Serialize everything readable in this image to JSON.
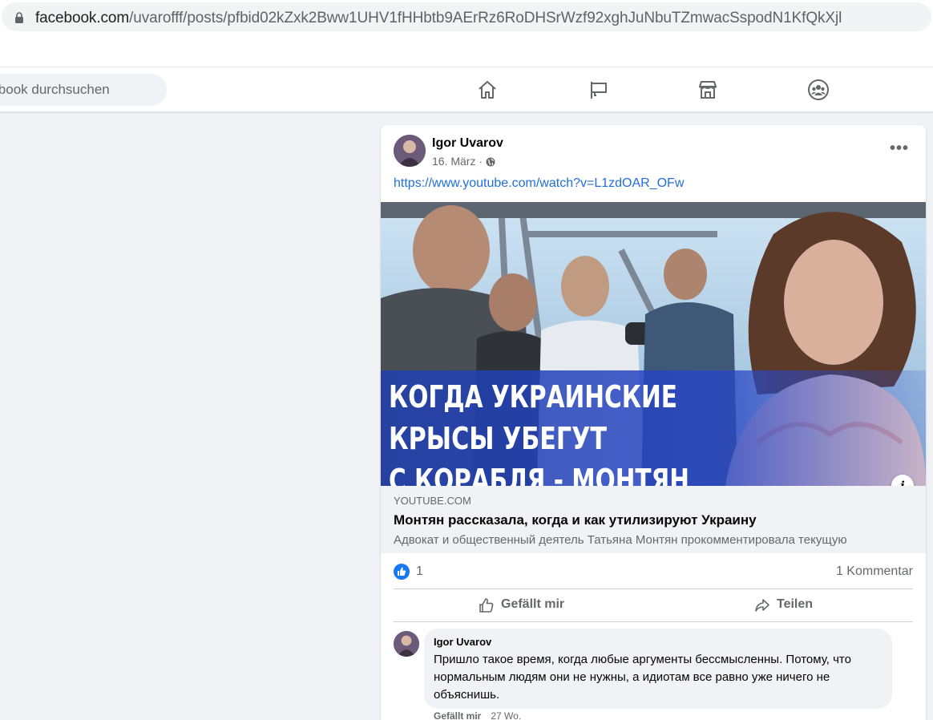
{
  "browser": {
    "url_host": "facebook.com",
    "url_path": "/uvarofff/posts/pfbid02kZxk2Bww1UHV1fHHbtb9AErRz6RoDHSrWzf92xghJuNbuTZmwacSspodN1KfQkXjl"
  },
  "nav": {
    "search_placeholder": "Facebook durchsuchen",
    "icons": [
      "home-icon",
      "pages-flag-icon",
      "marketplace-icon",
      "groups-icon"
    ]
  },
  "post": {
    "author": "Igor Uvarov",
    "date": "16. März · ",
    "link": "https://www.youtube.com/watch?v=L1zdOAR_OFw",
    "thumbnail_caption": [
      "КОГДА УКРАИНСКИЕ",
      "КРЫСЫ УБЕГУТ",
      "С КОРАБЛЯ - МОНТЯН"
    ],
    "preview": {
      "domain": "YOUTUBE.COM",
      "title": "Монтян рассказала, когда и как утилизируют Украину",
      "description": "Адвокат и общественный деятель Татьяна Монтян прокомментировала текущую"
    },
    "reactions": {
      "like_count": "1",
      "comments": "1 Kommentar"
    },
    "actions": {
      "like": "Gefällt mir",
      "share": "Teilen"
    }
  },
  "comment": {
    "author": "Igor Uvarov",
    "text": "Пришло такое время, когда любые аргументы бессмысленны. Потому, что нормальным людям они не нужны, а идиотам все равно уже ничего не объяснишь.",
    "like_label": "Gefällt mir",
    "time": "27 Wo."
  },
  "colors": {
    "link": "#216fdb",
    "like_blue": "#1877f2",
    "banner_blue": "#1f3fae"
  }
}
